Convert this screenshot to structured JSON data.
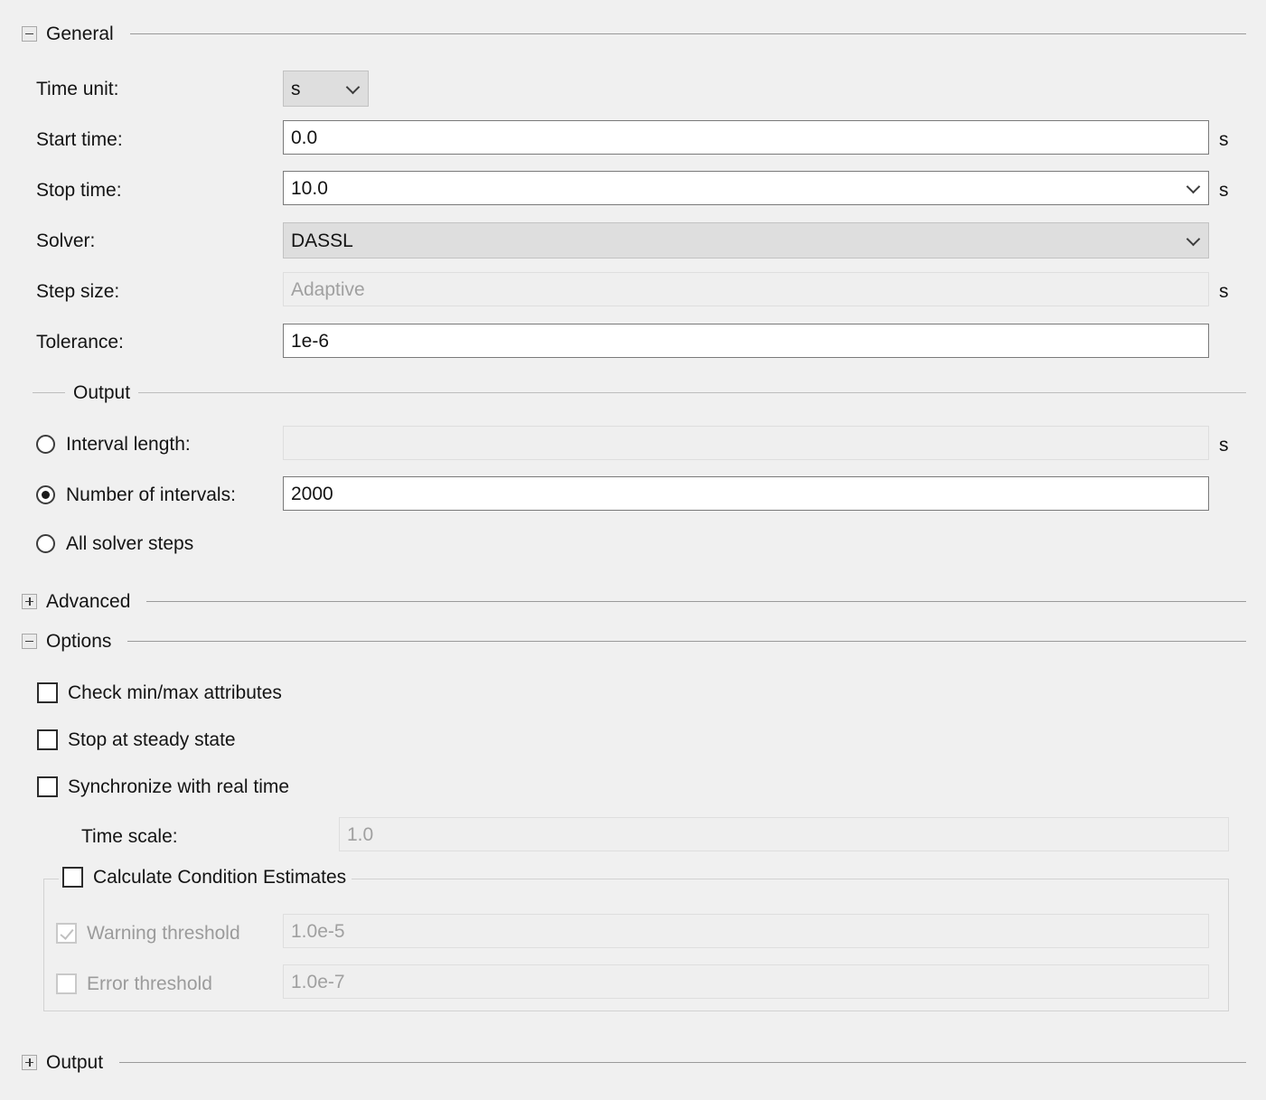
{
  "sections": {
    "general": {
      "title": "General",
      "expanded": true,
      "toggle_icon": "minus-box-icon"
    },
    "advanced": {
      "title": "Advanced",
      "expanded": false,
      "toggle_icon": "plus-box-icon"
    },
    "options": {
      "title": "Options",
      "expanded": true,
      "toggle_icon": "minus-box-icon"
    },
    "output_bottom": {
      "title": "Output",
      "expanded": false,
      "toggle_icon": "plus-box-icon"
    }
  },
  "general": {
    "time_unit": {
      "label": "Time unit:",
      "value": "s",
      "chevron": "chevron-down-icon"
    },
    "start_time": {
      "label": "Start time:",
      "value": "0.0",
      "unit": "s"
    },
    "stop_time": {
      "label": "Stop time:",
      "value": "10.0",
      "unit": "s",
      "chevron": "chevron-down-icon"
    },
    "solver": {
      "label": "Solver:",
      "value": "DASSL",
      "chevron": "chevron-down-icon"
    },
    "step_size": {
      "label": "Step size:",
      "value": "",
      "placeholder": "Adaptive",
      "unit": "s",
      "disabled": true
    },
    "tolerance": {
      "label": "Tolerance:",
      "value": "1e-6"
    },
    "output_group": {
      "title": "Output",
      "interval_length": {
        "label": "Interval length:",
        "value": "",
        "unit": "s",
        "selected": false,
        "disabled": true
      },
      "number_of_intervals": {
        "label": "Number of intervals:",
        "value": "2000",
        "selected": true
      },
      "all_solver_steps": {
        "label": "All solver steps",
        "selected": false
      }
    }
  },
  "options": {
    "check_min_max": {
      "label": "Check min/max attributes",
      "checked": false
    },
    "stop_at_steady_state": {
      "label": "Stop at steady state",
      "checked": false
    },
    "synchronize_with_real_time": {
      "label": "Synchronize with real time",
      "checked": false
    },
    "time_scale": {
      "label": "Time scale:",
      "value": "",
      "placeholder": "1.0",
      "disabled": true
    },
    "condition_estimates": {
      "title": "Calculate Condition Estimates",
      "checked": false,
      "warning_threshold": {
        "label": "Warning threshold",
        "checked": true,
        "disabled": true,
        "value": "",
        "placeholder": "1.0e-5"
      },
      "error_threshold": {
        "label": "Error threshold",
        "checked": false,
        "disabled": true,
        "value": "",
        "placeholder": "1.0e-7"
      }
    }
  },
  "colors": {
    "background": "#f0f0f0",
    "field_border": "#7a7a7a",
    "disabled_text": "#a0a0a0",
    "dropdown_bg": "#dedede",
    "rule": "#9a9a9a"
  }
}
